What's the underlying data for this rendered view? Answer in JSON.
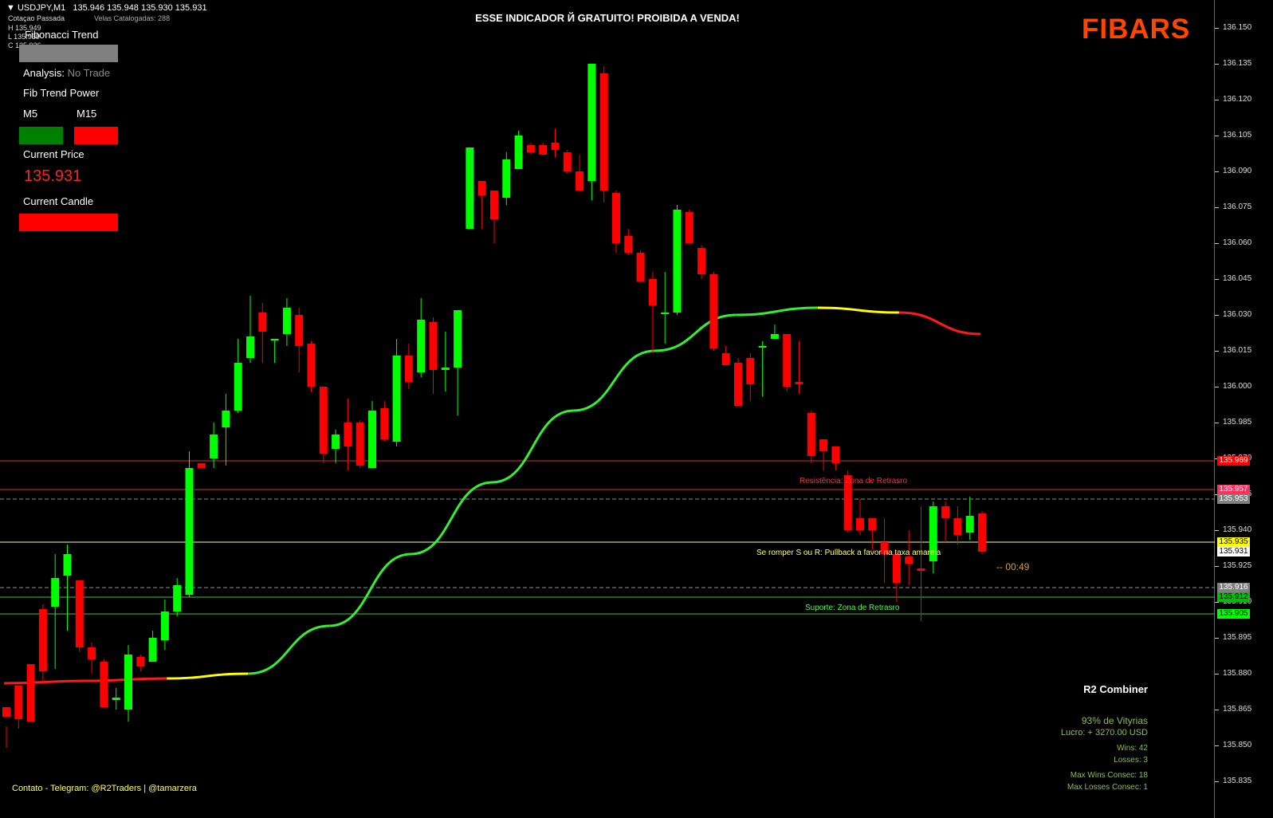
{
  "header": {
    "symbol": "USDJPY,M1",
    "ohlc_values": "135.946 135.948 135.930 135.931",
    "cotacao_label": "Cotaçao Passada",
    "velas_label": "Velas Catalogadas: 288",
    "h_line": "H 135.949",
    "l_line": "L 135.930",
    "c_line": "C 135.936",
    "headline": "ESSE INDICADOR Й GRATUITO! PROIBIDA A VENDA!",
    "logo": "FIBARS"
  },
  "panel": {
    "title": "Fibonacci Trend",
    "analysis_label": "Analysis:",
    "analysis_value": "No Trade",
    "power_label": "Fib Trend Power",
    "m5_label": "M5",
    "m15_label": "M15",
    "current_price_label": "Current Price",
    "current_price_value": "135.931",
    "current_candle_label": "Current Candle",
    "colors": {
      "title_box": "#808080",
      "m5": "#008000",
      "m15": "#ff0000",
      "candle": "#ff0000",
      "price_text": "#ff2020"
    }
  },
  "zones": {
    "resistance_label": "Resistência: Zona de Retrasro",
    "pullback_label": "Se romper S ou R: Pullback  a favor na taxa amarela",
    "support_label": "Suporte: Zona de Retrasro",
    "timer": "--  00:49"
  },
  "axis": {
    "ticks": [
      "136.150",
      "136.135",
      "136.120",
      "136.105",
      "136.090",
      "136.075",
      "136.060",
      "136.045",
      "136.030",
      "136.015",
      "136.000",
      "135.985",
      "135.970",
      "135.955",
      "135.940",
      "135.925",
      "135.910",
      "135.895",
      "135.880",
      "135.865",
      "135.850",
      "135.835"
    ],
    "tags": [
      {
        "value": "135.969",
        "bg": "#ff0000",
        "fg": "#ffffff"
      },
      {
        "value": "135.957",
        "bg": "#ff3060",
        "fg": "#ffffff"
      },
      {
        "value": "135.953",
        "bg": "#808080",
        "fg": "#ffffff"
      },
      {
        "value": "135.935",
        "bg": "#ffff00",
        "fg": "#000000"
      },
      {
        "value": "135.931",
        "bg": "#ffffff",
        "fg": "#000000"
      },
      {
        "value": "135.916",
        "bg": "#808080",
        "fg": "#ffffff"
      },
      {
        "value": "135.912",
        "bg": "#00c000",
        "fg": "#000000"
      },
      {
        "value": "135.905",
        "bg": "#00ff00",
        "fg": "#000000"
      }
    ]
  },
  "stats": {
    "title": "R2 Combiner",
    "win_rate": "93% de Vityrias",
    "profit": "Lucro: + 3270.00 USD",
    "wins": "Wins: 42",
    "losses": "Losses: 3",
    "max_wins": "Max Wins Consec: 18",
    "max_losses": "Max Losses Consec: 1"
  },
  "footer": {
    "contact": "Contato - Telegram: @R2Traders | @tamarzera"
  },
  "chart_data": {
    "type": "candlestick",
    "symbol": "USDJPY,M1",
    "ylim": [
      135.835,
      136.15
    ],
    "candles": [
      [
        135.866,
        135.862,
        135.858,
        135.849
      ],
      [
        135.875,
        135.861,
        135.872,
        135.857
      ],
      [
        135.884,
        135.86,
        135.88,
        135.868
      ],
      [
        135.907,
        135.881,
        135.909,
        135.876
      ],
      [
        135.908,
        135.92,
        135.93,
        135.882
      ],
      [
        135.921,
        135.93,
        135.934,
        135.898
      ],
      [
        135.919,
        135.891,
        135.919,
        135.889
      ],
      [
        135.891,
        135.886,
        135.893,
        135.88
      ],
      [
        135.885,
        135.866,
        135.886,
        135.866
      ],
      [
        135.869,
        135.87,
        135.874,
        135.865
      ],
      [
        135.865,
        135.888,
        135.892,
        135.86
      ],
      [
        135.887,
        135.883,
        135.888,
        135.881
      ],
      [
        135.885,
        135.895,
        135.898,
        135.885
      ],
      [
        135.894,
        135.906,
        135.911,
        135.89
      ],
      [
        135.906,
        135.917,
        135.92,
        135.904
      ],
      [
        135.913,
        135.966,
        135.973,
        135.912
      ],
      [
        135.968,
        135.966,
        135.968,
        135.966
      ],
      [
        135.97,
        135.98,
        135.985,
        135.966
      ],
      [
        135.983,
        135.99,
        135.997,
        135.967
      ],
      [
        135.99,
        136.01,
        136.02,
        135.989
      ],
      [
        136.012,
        136.021,
        136.038,
        136.01
      ],
      [
        136.031,
        136.023,
        136.035,
        136.01
      ],
      [
        136.02,
        136.02,
        136.02,
        136.01
      ],
      [
        136.022,
        136.033,
        136.037,
        136.017
      ],
      [
        136.03,
        136.017,
        136.033,
        136.006
      ],
      [
        136.018,
        136.0,
        136.019,
        135.998
      ],
      [
        136.0,
        135.972,
        136.0,
        135.968
      ],
      [
        135.974,
        135.98,
        135.982,
        135.968
      ],
      [
        135.985,
        135.975,
        135.995,
        135.965
      ],
      [
        135.985,
        135.967,
        135.986,
        135.966
      ],
      [
        135.966,
        135.99,
        135.994,
        135.967
      ],
      [
        135.991,
        135.978,
        135.994,
        135.977
      ],
      [
        135.977,
        136.013,
        136.02,
        135.975
      ],
      [
        136.013,
        136.002,
        136.018,
        135.999
      ],
      [
        136.006,
        136.028,
        136.037,
        136.004
      ],
      [
        136.027,
        136.007,
        136.029,
        135.997
      ],
      [
        136.007,
        136.008,
        136.023,
        135.998
      ],
      [
        136.008,
        136.032,
        136.032,
        135.988
      ],
      [
        136.066,
        136.1,
        136.099,
        136.07
      ],
      [
        136.086,
        136.08,
        136.084,
        136.066
      ],
      [
        136.082,
        136.07,
        136.077,
        136.06
      ],
      [
        136.079,
        136.095,
        136.098,
        136.076
      ],
      [
        136.091,
        136.105,
        136.107,
        136.092
      ],
      [
        136.101,
        136.098,
        136.102,
        136.097
      ],
      [
        136.101,
        136.097,
        136.102,
        136.097
      ],
      [
        136.102,
        136.099,
        136.108,
        136.096
      ],
      [
        136.098,
        136.09,
        136.099,
        136.089
      ],
      [
        136.09,
        136.082,
        136.097,
        136.085
      ],
      [
        136.086,
        136.135,
        136.135,
        136.078
      ],
      [
        136.131,
        136.082,
        136.134,
        136.077
      ],
      [
        136.081,
        136.06,
        136.082,
        136.056
      ],
      [
        136.063,
        136.056,
        136.066,
        136.055
      ],
      [
        136.056,
        136.044,
        136.057,
        136.044
      ],
      [
        136.045,
        136.034,
        136.048,
        136.014
      ],
      [
        136.031,
        136.031,
        136.048,
        136.018
      ],
      [
        136.031,
        136.074,
        136.076,
        136.03
      ],
      [
        136.073,
        136.06,
        136.074,
        136.06
      ],
      [
        136.058,
        136.047,
        136.059,
        136.045
      ],
      [
        136.047,
        136.016,
        136.048,
        136.015
      ],
      [
        136.014,
        136.009,
        136.017,
        136.009
      ],
      [
        136.01,
        135.992,
        136.012,
        135.993
      ],
      [
        136.012,
        136.001,
        136.014,
        135.994
      ],
      [
        136.017,
        136.017,
        136.019,
        135.996
      ],
      [
        136.02,
        136.022,
        136.026,
        136.021
      ],
      [
        136.022,
        136.0,
        136.022,
        135.998
      ],
      [
        136.002,
        136.001,
        136.019,
        135.997
      ],
      [
        135.989,
        135.971,
        135.99,
        135.968
      ],
      [
        135.978,
        135.973,
        135.978,
        135.965
      ],
      [
        135.975,
        135.968,
        135.975,
        135.965
      ],
      [
        135.963,
        135.94,
        135.965,
        135.939
      ],
      [
        135.945,
        135.94,
        135.953,
        135.938
      ],
      [
        135.945,
        135.94,
        135.945,
        135.932
      ],
      [
        135.935,
        135.93,
        135.945,
        135.918
      ],
      [
        135.93,
        135.918,
        135.931,
        135.91
      ],
      [
        135.929,
        135.926,
        135.94,
        135.917
      ],
      [
        135.924,
        135.923,
        135.95,
        135.902
      ],
      [
        135.927,
        135.95,
        135.952,
        135.922
      ],
      [
        135.95,
        135.945,
        135.952,
        135.935
      ],
      [
        135.945,
        135.938,
        135.95,
        135.934
      ],
      [
        135.939,
        135.946,
        135.954,
        135.936
      ],
      [
        135.947,
        135.931,
        135.948,
        135.93
      ]
    ],
    "bullish_color": "#00ff00",
    "bearish_color": "#ff0000",
    "trend_line": [
      [
        135.876,
        "red"
      ],
      [
        135.877,
        "red"
      ],
      [
        135.878,
        "yellow"
      ],
      [
        135.88,
        "green"
      ],
      [
        135.9,
        "green"
      ],
      [
        135.93,
        "green"
      ],
      [
        135.96,
        "green"
      ],
      [
        135.99,
        "green"
      ],
      [
        136.015,
        "green"
      ],
      [
        136.03,
        "green"
      ],
      [
        136.033,
        "yellow"
      ],
      [
        136.031,
        "red"
      ],
      [
        136.022,
        "red"
      ]
    ],
    "levels": [
      {
        "value": 135.969,
        "color": "#d03030",
        "style": "solid"
      },
      {
        "value": 135.957,
        "color": "#d03030",
        "style": "solid"
      },
      {
        "value": 135.953,
        "color": "#909090",
        "style": "dashed"
      },
      {
        "value": 135.935,
        "color": "#ffff80",
        "style": "solid"
      },
      {
        "value": 135.916,
        "color": "#909090",
        "style": "dashed"
      },
      {
        "value": 135.912,
        "color": "#40c040",
        "style": "solid"
      },
      {
        "value": 135.905,
        "color": "#40c040",
        "style": "solid"
      }
    ]
  }
}
